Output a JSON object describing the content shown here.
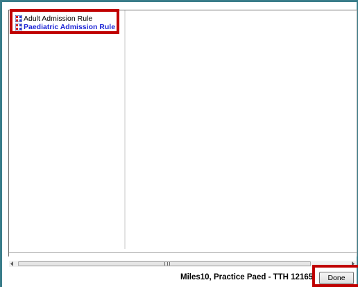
{
  "rules": [
    {
      "label": "Adult Admission Rule",
      "selected": false,
      "icon": "rule-flowchart-icon"
    },
    {
      "label": "Paediatric Admission Rule",
      "selected": true,
      "icon": "rule-flowchart-icon"
    }
  ],
  "scrollbar": {
    "grip": "III"
  },
  "footer": {
    "status": "Miles10, Practice Paed - TTH 12165",
    "done_label": "Done"
  },
  "colors": {
    "frame": "#3a7d8a",
    "highlight": "#c00000",
    "selected_text": "#1f27d6"
  }
}
